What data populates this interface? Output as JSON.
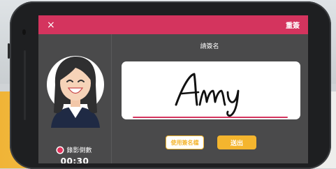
{
  "header": {
    "close_icon": "×",
    "reset_label": "重簽",
    "bar_color": "#d4345e"
  },
  "prompt": "請簽名",
  "signature": {
    "text": "Amy"
  },
  "recording": {
    "label": "錄影倒數",
    "countdown": "00:30"
  },
  "buttons": {
    "use_signature_label": "使用簽名檔",
    "send_label": "送出",
    "accent_color": "#f4b52e"
  },
  "icons": {
    "close": "close-icon",
    "avatar": "user-avatar",
    "record": "record-dot-icon"
  }
}
